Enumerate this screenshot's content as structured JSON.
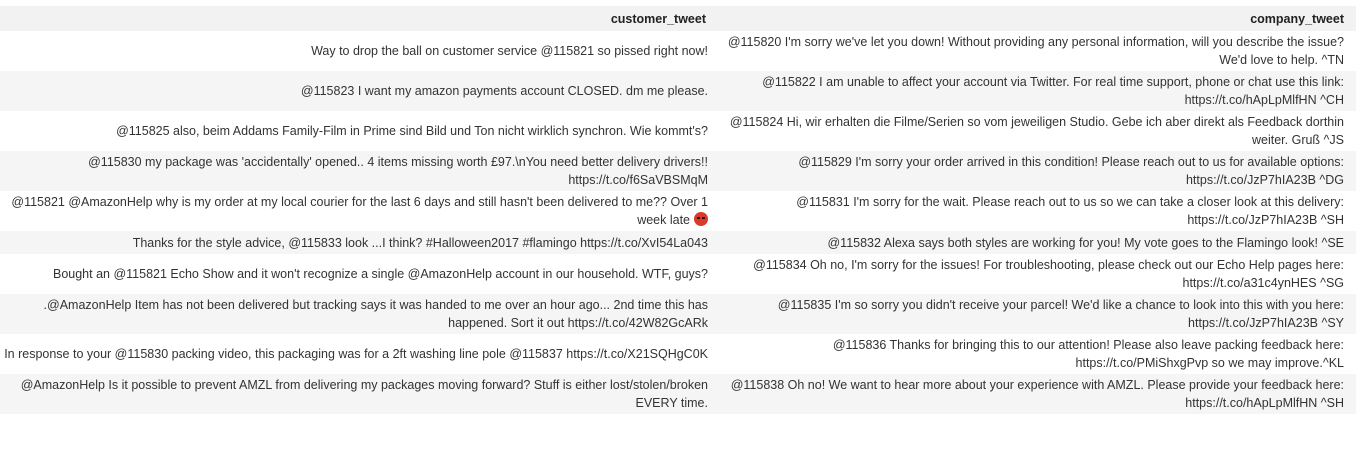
{
  "table": {
    "headers": {
      "customer_tweet": "customer_tweet",
      "company_tweet": "company_tweet"
    },
    "rows": [
      {
        "customer": "Way to drop the ball on customer service @115821 so pissed right now!",
        "company": "@115820 I'm sorry we've let you down! Without providing any personal information, will you describe the issue? We'd love to help. ^TN"
      },
      {
        "customer": "@115823 I want my amazon payments account CLOSED. dm me please.",
        "company": "@115822 I am unable to affect your account via Twitter. For real time support, phone or chat use this link: https://t.co/hApLpMlfHN ^CH"
      },
      {
        "customer": "@115825 also, beim Addams Family-Film in Prime sind Bild und Ton nicht wirklich synchron. Wie kommt's?",
        "company": "@115824 Hi, wir erhalten die Filme/Serien so vom jeweiligen Studio. Gebe ich aber direkt als Feedback dorthin weiter. Gruß ^JS"
      },
      {
        "customer": "@115830 my package was 'accidentally' opened.. 4 items missing worth £97.\\nYou need better delivery drivers!! https://t.co/f6SaVBSMqM",
        "company": "@115829 I'm sorry your order arrived in this condition! Please reach out to us for available options: https://t.co/JzP7hIA23B ^DG"
      },
      {
        "customer": "@115821 @AmazonHelp why is my order at my local courier for the last 6 days and still hasn't been delivered to me?? Over 1 week late",
        "customer_emoji": "angry-face-emoji",
        "company": "@115831 I'm sorry for the wait. Please reach out to us so we can take a closer look at this delivery: https://t.co/JzP7hIA23B ^SH"
      },
      {
        "customer": "Thanks for the style advice, @115833 look ...I think? #Halloween2017 #flamingo https://t.co/XvI54La043",
        "company": "@115832 Alexa says both styles are working for you! My vote goes to the Flamingo look! ^SE"
      },
      {
        "customer": "Bought an @115821 Echo Show and it won't recognize a single @AmazonHelp account in our household. WTF, guys?",
        "company": "@115834 Oh no, I'm sorry for the issues! For troubleshooting, please check out our Echo Help pages here: https://t.co/a31c4ynHES ^SG"
      },
      {
        "customer": ".@AmazonHelp Item has not been delivered but tracking says it was handed to me over an hour ago... 2nd time this has happened. Sort it out https://t.co/42W82GcARk",
        "company": "@115835 I'm so sorry you didn't receive your parcel! We'd like a chance to look into this with you here: https://t.co/JzP7hIA23B ^SY"
      },
      {
        "customer": "In response to your @115830 packing video, this packaging was for a 2ft washing line pole @115837 https://t.co/X21SQHgC0K",
        "company": "@115836 Thanks for bringing this to our attention! Please also leave packing feedback here: https://t.co/PMiShxgPvp so we may improve.^KL"
      },
      {
        "customer": "@AmazonHelp Is it possible to prevent AMZL from delivering my packages moving forward? Stuff is either lost/stolen/broken EVERY time.",
        "company": "@115838 Oh no! We want to hear more about your experience with AMZL. Please provide your feedback here: https://t.co/hApLpMlfHN ^SH"
      }
    ]
  }
}
